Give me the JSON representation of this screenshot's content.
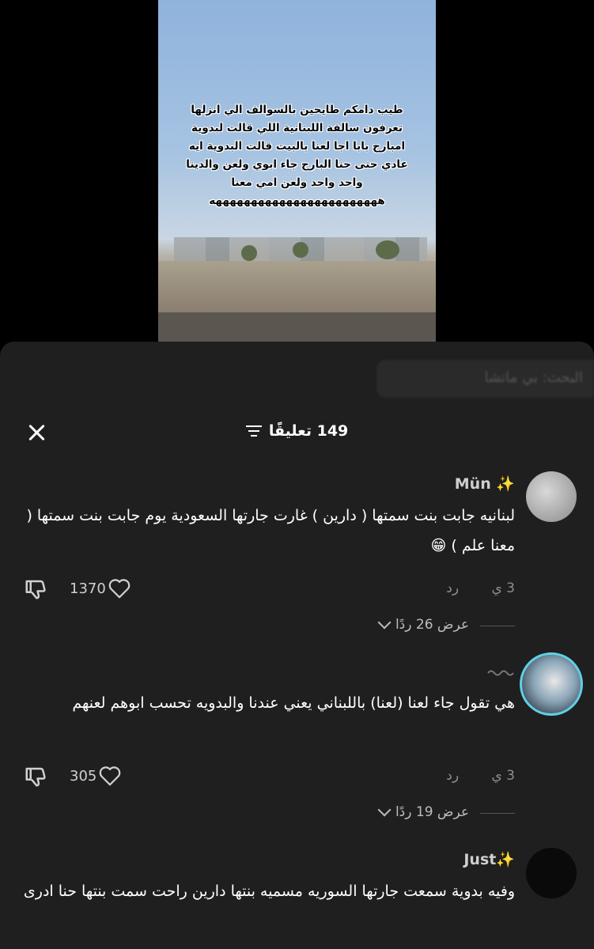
{
  "video": {
    "overlay_text": "طيب دامكم طايحين بالسوالف الي انزلها  تعرفون سالفة اللبنانية اللي قالت لبدوية امبارح بابا اجا لعنا بالبيت قالت البدوية ايه عادي حتى حنا البارح جاء ابوي ولعن والدينا واحد واحد ولعن امي معنا ههههههههههههههههههههههههه"
  },
  "ghost_search": "البحث: بي ماتشا",
  "header": {
    "title": "149 تعليقًا",
    "filter_icon": "filter-icon",
    "close_icon": "close-icon"
  },
  "comments": [
    {
      "username": "Mün ✨",
      "text": "لبنانيه جابت بنت سمتها  ( دارين ) غارت جارتها السعودية يوم جابت بنت سمتها  ( معنا علم ) 😁",
      "time": "3 ي",
      "reply": "رد",
      "likes": "1370",
      "views": "عرض 26 ردًا"
    },
    {
      "username": "",
      "text": "هي تقول جاء لعنا (لعنا) باللبناني يعني عندنا والبدويه تحسب ابوهم لعنهم",
      "time": "3 ي",
      "reply": "رد",
      "likes": "305",
      "views": "عرض 19 ردًا"
    },
    {
      "username": "Just✨",
      "text": "وفيه بدوية سمعت جارتها السوريه مسميه بنتها دارين راحت سمت بنتها حنا ادرى"
    }
  ],
  "colors": {
    "sheet_bg": "#1f1f1f",
    "accent_ring": "#5fd0e8"
  }
}
